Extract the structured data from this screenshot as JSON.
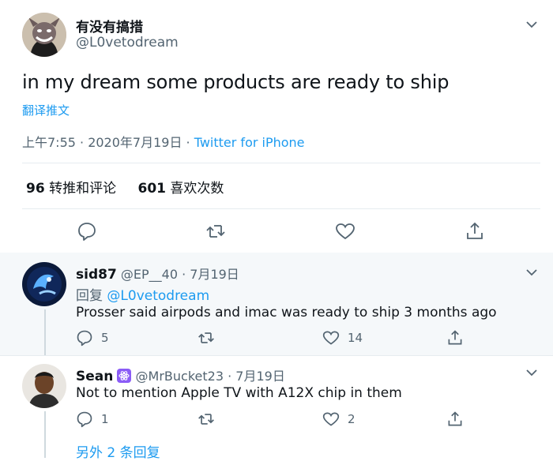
{
  "tweet": {
    "name": "有没有搞措",
    "handle": "@L0vetodream",
    "text": "in my dream some products are ready to ship",
    "translate": "翻译推文",
    "time": "上午7:55 · 2020年7月19日 · ",
    "source": "Twitter for iPhone",
    "retweets_count": "96",
    "retweets_label": "转推和评论",
    "likes_count": "601",
    "likes_label": "喜欢次数"
  },
  "replies": [
    {
      "name": "sid87",
      "handle": "@EP__40",
      "date": " · 7月19日",
      "reply_prefix": "回复 ",
      "reply_to": "@L0vetodream",
      "text": "Prosser said airpods and imac was ready to ship 3 months ago",
      "reply_count": "5",
      "like_count": "14"
    },
    {
      "name": "Sean",
      "handle": "@MrBucket23",
      "date": " · 7月19日",
      "text": "Not to mention Apple TV with A12X chip in them",
      "reply_count": "1",
      "like_count": "2"
    }
  ],
  "more_replies": "另外 2 条回复",
  "colors": {
    "accent": "#1d9bf0",
    "muted": "#536471",
    "highlight_bg": "#f5f8fa"
  }
}
